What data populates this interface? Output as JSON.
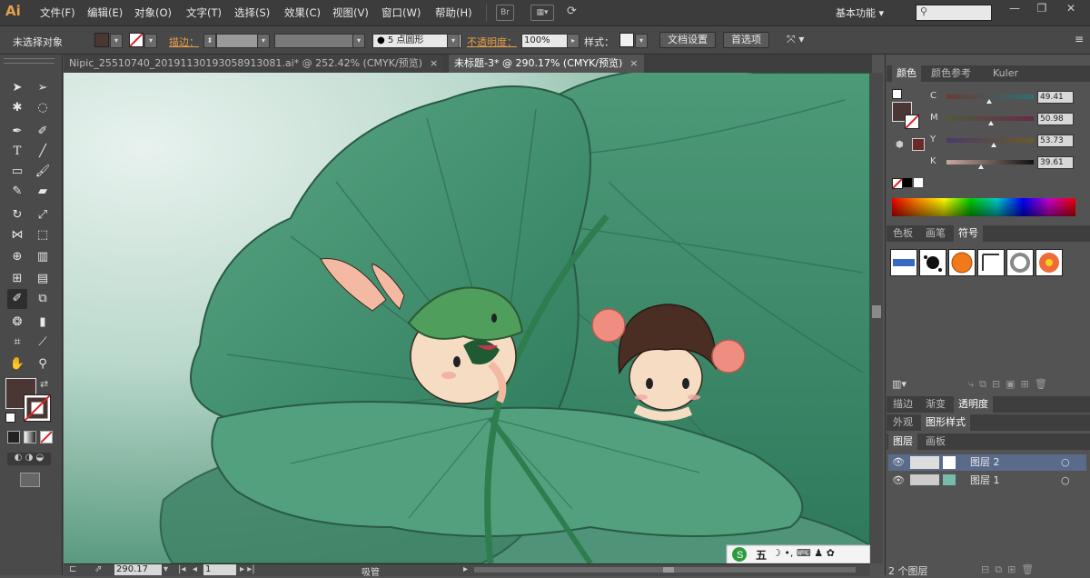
{
  "app": {
    "logo": "Ai"
  },
  "menu": [
    "文件(F)",
    "编辑(E)",
    "对象(O)",
    "文字(T)",
    "选择(S)",
    "效果(C)",
    "视图(V)",
    "窗口(W)",
    "帮助(H)"
  ],
  "menubar_extra": {
    "bridge": "Br",
    "workspace": "基本功能 ▾",
    "search_placeholder": ""
  },
  "control": {
    "selection": "未选择对象",
    "stroke_label": "描边：",
    "brush": "5 点圆形",
    "opacity_label": "不透明度：",
    "opacity_value": "100%",
    "style_label": "样式：",
    "doc_setup": "文档设置",
    "prefs": "首选项"
  },
  "tabs": [
    {
      "label": "Nipic_25510740_20191130193058913081.ai* @ 252.42% (CMYK/预览)",
      "close": "×"
    },
    {
      "label": "未标题-3* @ 290.17% (CMYK/预览)",
      "close": "×"
    }
  ],
  "color_panel": {
    "tabs": [
      "颜色",
      "颜色参考",
      "Kuler"
    ],
    "channels": [
      {
        "name": "C",
        "value": "49.41",
        "level": 0.49
      },
      {
        "name": "M",
        "value": "50.98",
        "level": 0.51
      },
      {
        "name": "Y",
        "value": "53.73",
        "level": 0.54
      },
      {
        "name": "K",
        "value": "39.61",
        "level": 0.4
      }
    ]
  },
  "swatch_panel": {
    "tabs": [
      "色板",
      "画笔",
      "符号"
    ]
  },
  "appearance_panel": {
    "tabs": [
      "描边",
      "渐变",
      "透明度"
    ]
  },
  "style_panel": {
    "tabs": [
      "外观",
      "图形样式"
    ]
  },
  "layers_panel": {
    "tabs": [
      "图层",
      "画板"
    ],
    "layers": [
      {
        "name": "图层 2"
      },
      {
        "name": "图层 1"
      }
    ],
    "footer": "2 个图层"
  },
  "status": {
    "zoom": "290.17",
    "page": "1",
    "mode": "吸管"
  },
  "ime": {
    "label": "五"
  },
  "colors": {
    "fill": "#4a3633",
    "stroke_none": "#ffffff",
    "accent_orange": "#e8a04a"
  }
}
